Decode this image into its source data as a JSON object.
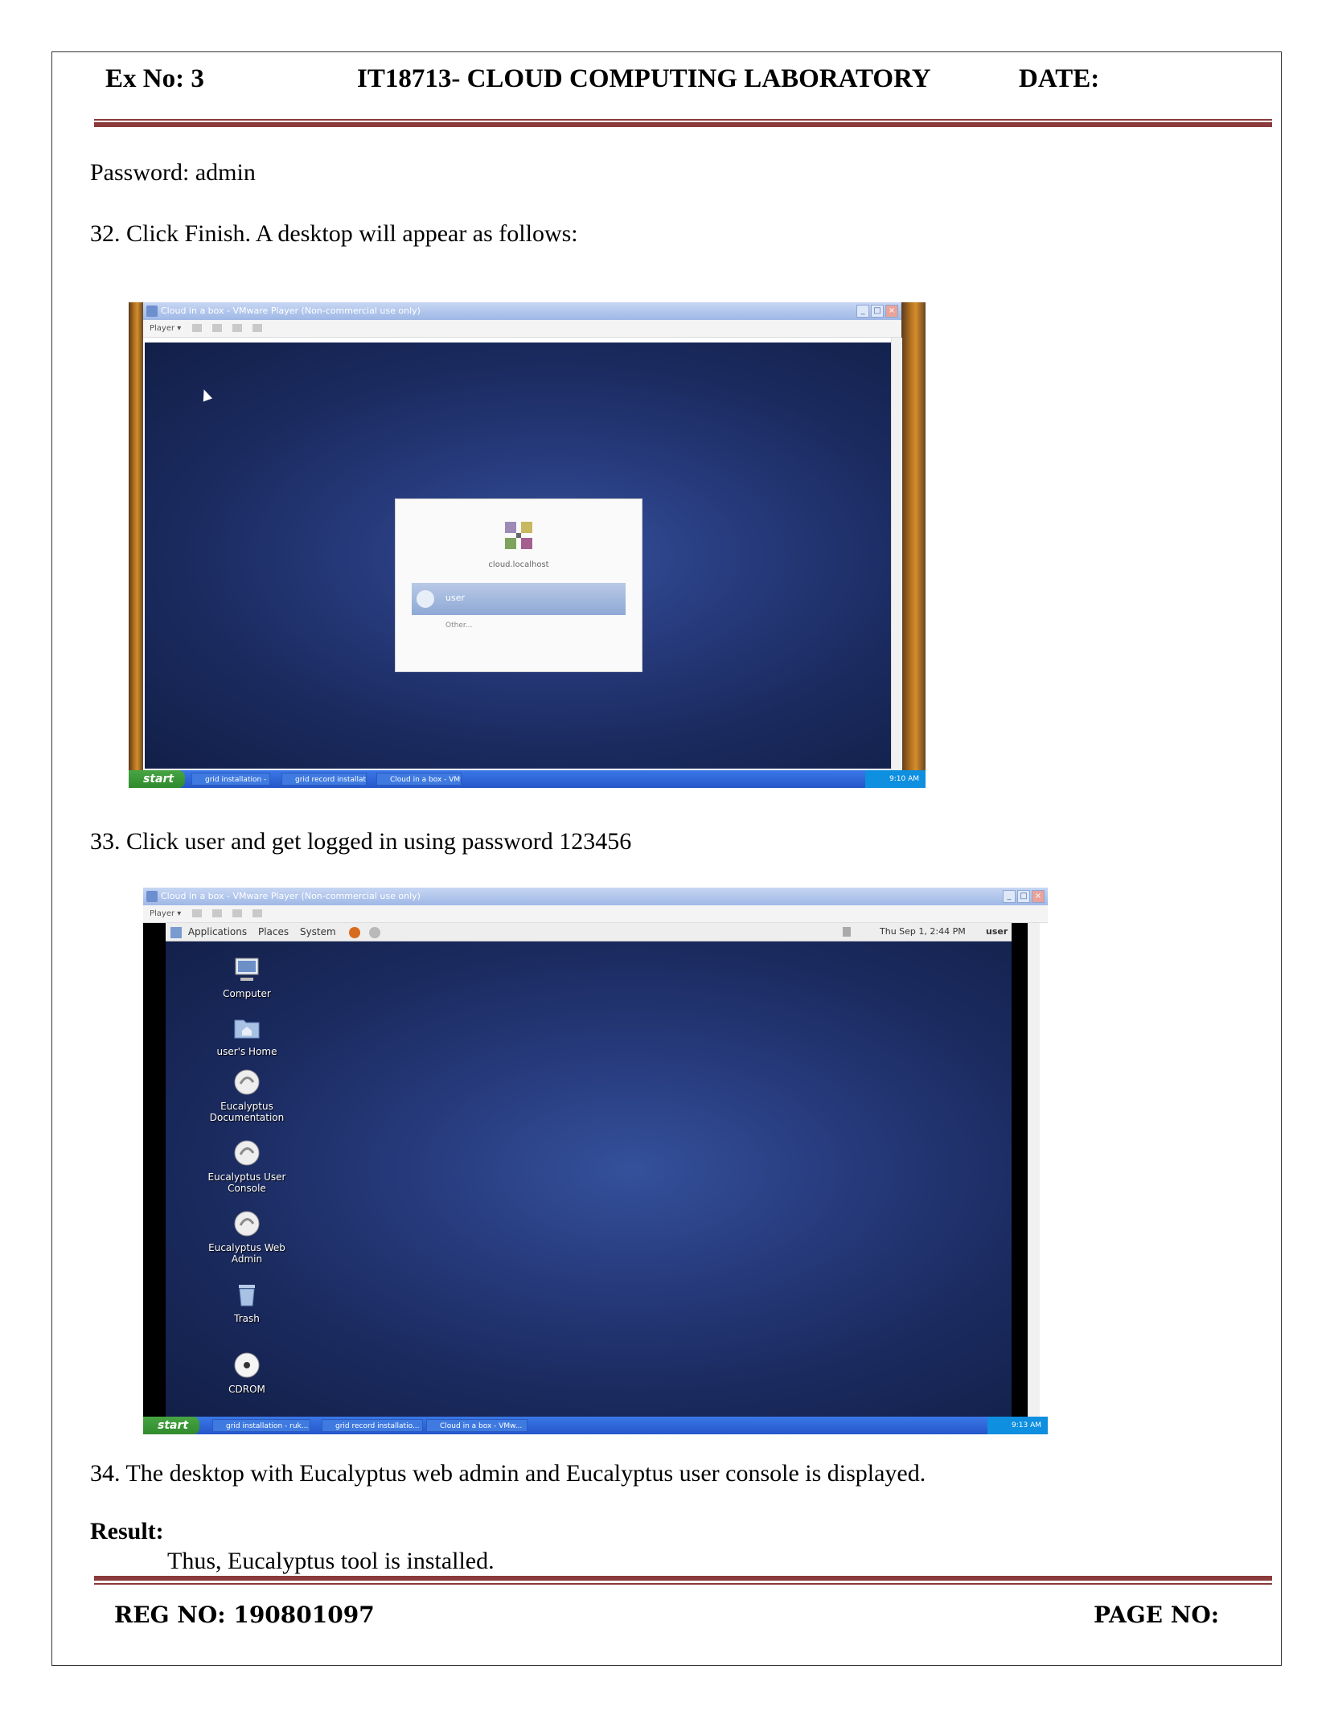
{
  "header": {
    "ex_no": "Ex No: 3",
    "course": "IT18713- CLOUD COMPUTING LABORATORY",
    "date": "DATE:"
  },
  "body": {
    "password_line": "Password: admin",
    "step32": "32. Click Finish. A desktop will appear as follows:",
    "step33": "33. Click user and get logged in using password 123456",
    "step34": "34.  The desktop with Eucalyptus web admin and Eucalyptus user console is displayed.",
    "result_label": "Result:",
    "result_text": "Thus, Eucalyptus tool is installed."
  },
  "screenshot1": {
    "title": "Cloud in a box - VMware Player (Non-commercial use only)",
    "toolbar_player": "Player ▾",
    "login_host": "cloud.localhost",
    "login_user": "user",
    "login_other": "Other...",
    "start": "start",
    "tasks": [
      "grid installation - ruk...",
      "grid record installatio...",
      "Cloud in a box - VMw..."
    ],
    "clock": "9:10 AM"
  },
  "screenshot2": {
    "title": "Cloud in a box - VMware Player (Non-commercial use only)",
    "toolbar_player": "Player ▾",
    "panel": {
      "applications": "Applications",
      "places": "Places",
      "system": "System",
      "datetime": "Thu Sep  1,  2:44 PM",
      "user": "user"
    },
    "icons": [
      "Computer",
      "user's Home",
      "Eucalyptus Documentation",
      "Eucalyptus User Console",
      "Eucalyptus Web Admin",
      "Trash",
      "CDROM"
    ],
    "start": "start",
    "tasks": [
      "grid installation - ruk...",
      "grid record installatio...",
      "Cloud in a box - VMw..."
    ],
    "clock": "9:13 AM"
  },
  "footer": {
    "reg_no": "REG NO: 190801097",
    "page_no": "PAGE NO:"
  }
}
